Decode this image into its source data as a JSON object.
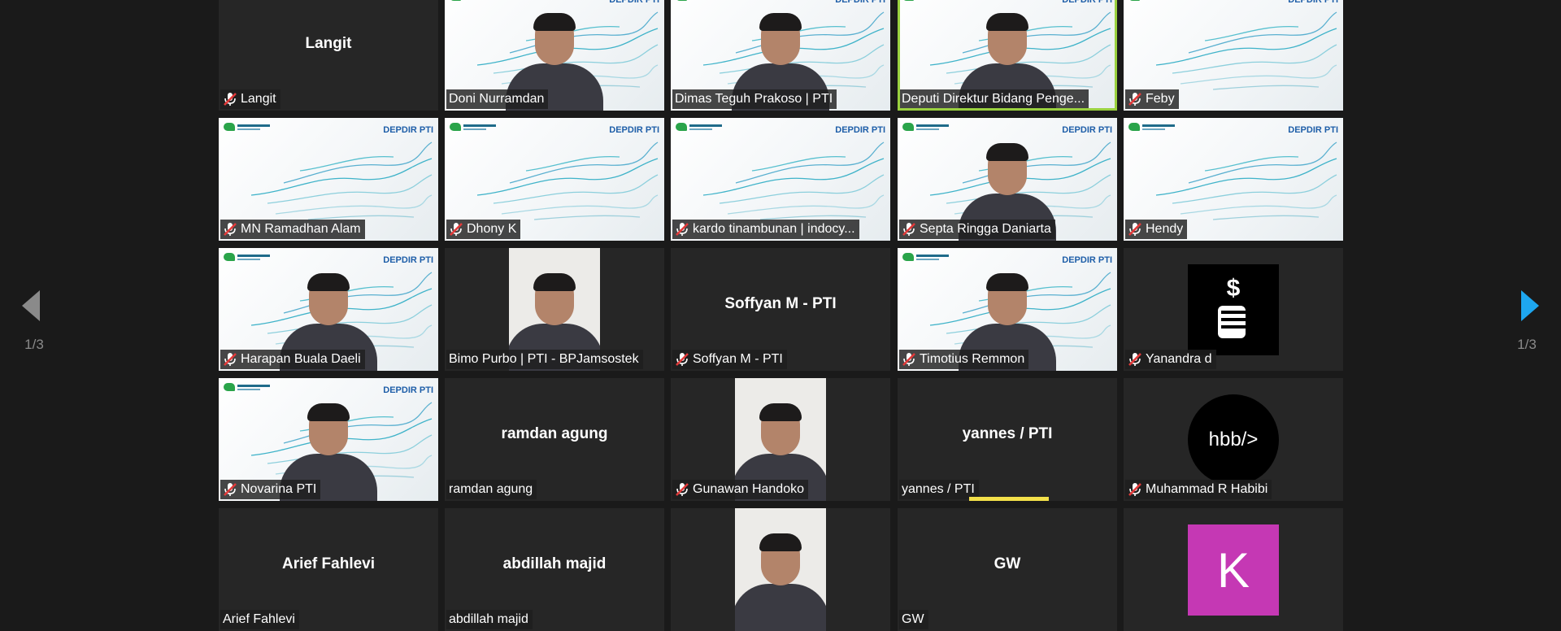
{
  "pagination": {
    "current_page": 1,
    "total_pages": 3,
    "left_label": "1/3",
    "right_label": "1/3"
  },
  "colors": {
    "arrow_prev": "#8a8a8a",
    "arrow_next": "#1ea7f0",
    "muted_mic": "#e23a3a",
    "active_border": "#9ad13f",
    "speaking_bar": "#f3e04a",
    "avatar_k": "#c538b4"
  },
  "branding": {
    "overlay_text": "DEPDIR PTI"
  },
  "participants": [
    {
      "name": "Langit",
      "center_name": "Langit",
      "muted": true,
      "video": "none"
    },
    {
      "name": "Doni Nurramdan",
      "muted": false,
      "video": "person"
    },
    {
      "name": "Dimas Teguh Prakoso | PTI",
      "muted": false,
      "video": "person"
    },
    {
      "name": "Deputi Direktur Bidang Penge...",
      "muted": false,
      "video": "person",
      "active": true
    },
    {
      "name": "Feby",
      "muted": true,
      "video": "background"
    },
    {
      "name": "MN Ramadhan Alam",
      "muted": true,
      "video": "background"
    },
    {
      "name": "Dhony K",
      "muted": true,
      "video": "background"
    },
    {
      "name": "kardo tinambunan | indocy...",
      "muted": true,
      "video": "background"
    },
    {
      "name": "Septa Ringga Daniarta",
      "muted": true,
      "video": "person"
    },
    {
      "name": "Hendy",
      "muted": true,
      "video": "background"
    },
    {
      "name": "Harapan Buala Daeli",
      "muted": true,
      "video": "person"
    },
    {
      "name": "Bimo Purbo | PTI - BPJamsostek",
      "muted": false,
      "video": "portrait"
    },
    {
      "name": "Soffyan M - PTI",
      "center_name": "Soffyan M - PTI",
      "muted": true,
      "video": "none"
    },
    {
      "name": "Timotius Remmon",
      "muted": true,
      "video": "person"
    },
    {
      "name": "Yanandra d",
      "muted": true,
      "video": "avatar",
      "avatar": "dollar-icon"
    },
    {
      "name": "Novarina PTI",
      "muted": true,
      "video": "person"
    },
    {
      "name": "ramdan agung",
      "center_name": "ramdan agung",
      "muted": false,
      "video": "none"
    },
    {
      "name": "Gunawan Handoko",
      "muted": true,
      "video": "portrait"
    },
    {
      "name": "yannes / PTI",
      "center_name": "yannes / PTI",
      "muted": false,
      "video": "none",
      "speaking": true
    },
    {
      "name": "Muhammad R Habibi",
      "muted": true,
      "video": "avatar",
      "avatar": "hbb",
      "avatar_text": "hbb/>"
    },
    {
      "name": "Arief Fahlevi",
      "center_name": "Arief Fahlevi",
      "muted": false,
      "video": "none"
    },
    {
      "name": "abdillah majid",
      "center_name": "abdillah majid",
      "muted": false,
      "video": "none"
    },
    {
      "name": "",
      "muted": false,
      "video": "portrait"
    },
    {
      "name": "GW",
      "center_name": "GW",
      "muted": false,
      "video": "none"
    },
    {
      "name": "",
      "muted": false,
      "video": "avatar",
      "avatar": "letter",
      "avatar_text": "K"
    }
  ]
}
